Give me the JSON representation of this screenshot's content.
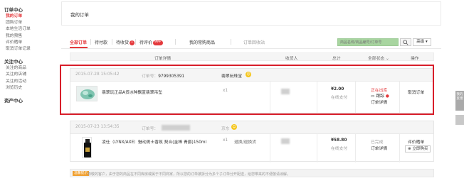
{
  "sidebar": {
    "groups": [
      {
        "title": "订单中心",
        "items": [
          "我的订单",
          "团购订单",
          "本地生活订单",
          "我的预售",
          "评价晒单",
          "取消订单记录"
        ]
      },
      {
        "title": "关注中心",
        "items": [
          "关注的商品",
          "关注的店铺",
          "关注的活动",
          "浏览历史"
        ]
      },
      {
        "title": "资产中心",
        "items": []
      }
    ],
    "active_item": "我的订单"
  },
  "page_title": "我的订单",
  "tabs": [
    {
      "label": "全部订单",
      "active": true
    },
    {
      "label": "待付款"
    },
    {
      "label": "待收货",
      "badge": "1"
    },
    {
      "label": "待评价",
      "badge": "99+"
    },
    {
      "label": "我的常购商品"
    },
    {
      "label": "订单回收站"
    }
  ],
  "search": {
    "placeholder": "商品名称/商品编号/订单号",
    "adv_label": "高级"
  },
  "table_headers": {
    "detail": "订单详情",
    "receiver": "收货人",
    "amount": "总计",
    "status": "全部状态",
    "action": "操作"
  },
  "orders": [
    {
      "date": "2015-07-28 15:05:42",
      "order_no_label": "订单号：",
      "order_no": "9799305391",
      "shop": "翡翠玩珠宝",
      "product": "翡翠玩正品A货冰种飘蓝翡翠吊坠",
      "qty": "x1",
      "amount": "¥2.00",
      "payment": "在线支付",
      "status": "正在出库",
      "track": "跟踪",
      "detail_link": "订单详情",
      "action": "取消订单"
    },
    {
      "date": "2015-07-23 13:54:35",
      "order_no_label": "订单号：",
      "order_no": "",
      "shop": "京东",
      "product": "凌仕（LYNX/AXE）魅动男士香氛 契合(金棒 青爵)150ml",
      "qty": "x1",
      "return_label": "退换/退换货",
      "amount": "¥58.80",
      "payment": "在线支付",
      "status": "已完成",
      "detail_link": "订单详情",
      "action": "评价晒单",
      "buy_again": "立即购买"
    }
  ],
  "notice": {
    "tag": "温馨提示",
    "text": "尊敬的客户，由于您的商品在不同库房或属于不同商家，所以您的订单被拆分为多个子订单分开配送，给您带来的不便敬请谅解。"
  },
  "float": {
    "label": "我的反馈"
  },
  "colors": {
    "accent": "#e4393c",
    "highlight": "#d81e2a",
    "search_green": "#a8d5a0"
  }
}
